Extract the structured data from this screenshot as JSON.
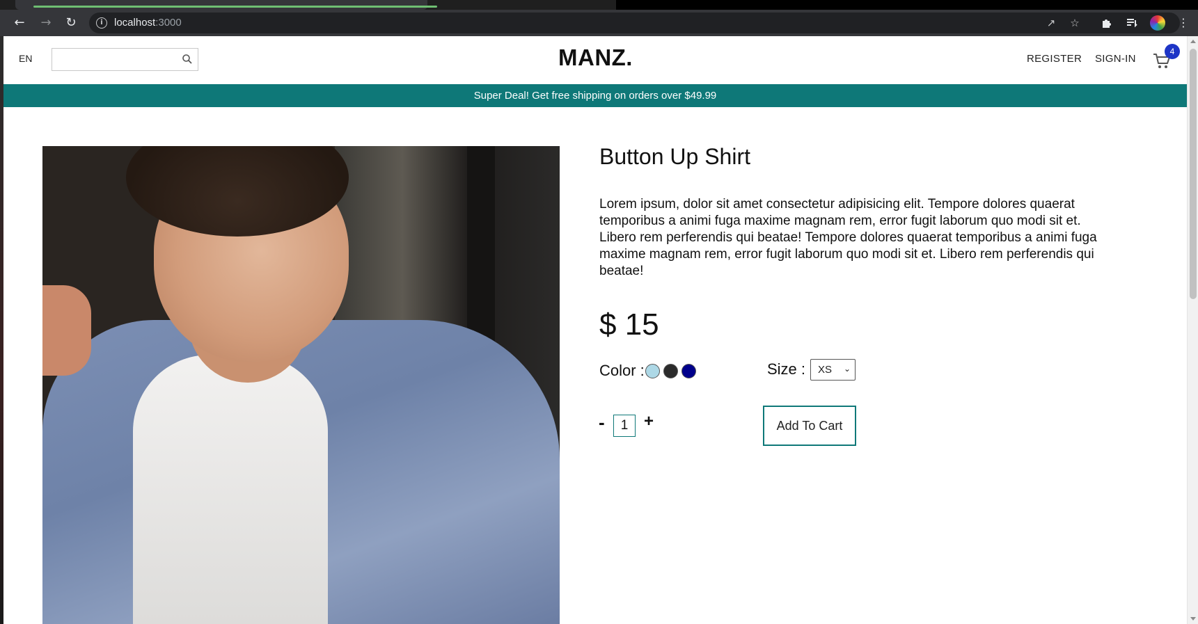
{
  "browser": {
    "url_host": "localhost",
    "url_port": ":3000",
    "icons": [
      "back-arrow-icon",
      "forward-arrow-icon",
      "reload-icon",
      "info-icon",
      "share-icon",
      "star-icon",
      "extensions-icon",
      "reading-list-icon",
      "profile-avatar",
      "more-menu-icon"
    ]
  },
  "navbar": {
    "language": "EN",
    "search_placeholder": "",
    "logo": "MANZ.",
    "register": "REGISTER",
    "signin": "SIGN-IN",
    "cart_count": "4"
  },
  "announcement": "Super Deal! Get free shipping on orders over $49.99",
  "product": {
    "title": "Button Up Shirt",
    "description": "Lorem ipsum, dolor sit amet consectetur adipisicing elit. Tempore dolores quaerat temporibus a animi fuga maxime magnam rem, error fugit laborum quo modi sit et. Libero rem perferendis qui beatae! Tempore dolores quaerat temporibus a animi fuga maxime magnam rem, error fugit laborum quo modi sit et. Libero rem perferendis qui beatae!",
    "price": "$ 15",
    "color_label": "Color :",
    "colors": [
      "#add8e6",
      "#2b2b2b",
      "#00008b"
    ],
    "size_label": "Size :",
    "size_selected": "XS",
    "qty_minus": "-",
    "quantity": "1",
    "qty_plus": "+",
    "add_to_cart": "Add To Cart"
  },
  "colors": {
    "accent": "#0e7878",
    "badge": "#1e35c6"
  }
}
